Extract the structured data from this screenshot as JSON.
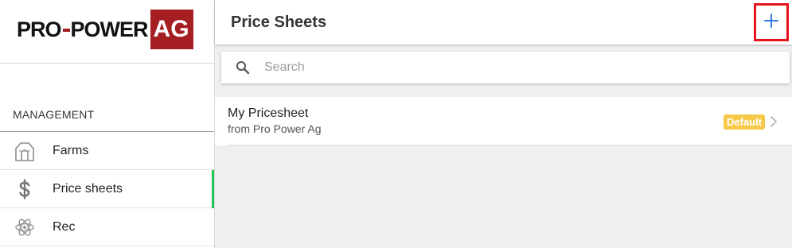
{
  "brand": {
    "logo_text": "PRO-POWER",
    "logo_pro": "PRO",
    "logo_power": "POWER",
    "logo_ag": "AG",
    "accent": "#a51e22"
  },
  "sidebar": {
    "section_title": "MANAGEMENT",
    "items": [
      {
        "label": "Farms",
        "icon": "barn-icon",
        "active": false
      },
      {
        "label": "Price sheets",
        "icon": "dollar-icon",
        "active": true
      },
      {
        "label": "Rec",
        "icon": "atom-icon",
        "active": false
      }
    ],
    "active_color": "#23c552"
  },
  "header": {
    "title": "Price Sheets",
    "add_button_icon": "plus-icon",
    "highlight_color": "#e8141b",
    "plus_color": "#2f7be0"
  },
  "search": {
    "placeholder": "Search",
    "value": ""
  },
  "pricesheets": [
    {
      "name": "My Pricesheet",
      "subtitle": "from Pro Power Ag",
      "badge": "Default",
      "badge_color": "#f7c948"
    }
  ]
}
